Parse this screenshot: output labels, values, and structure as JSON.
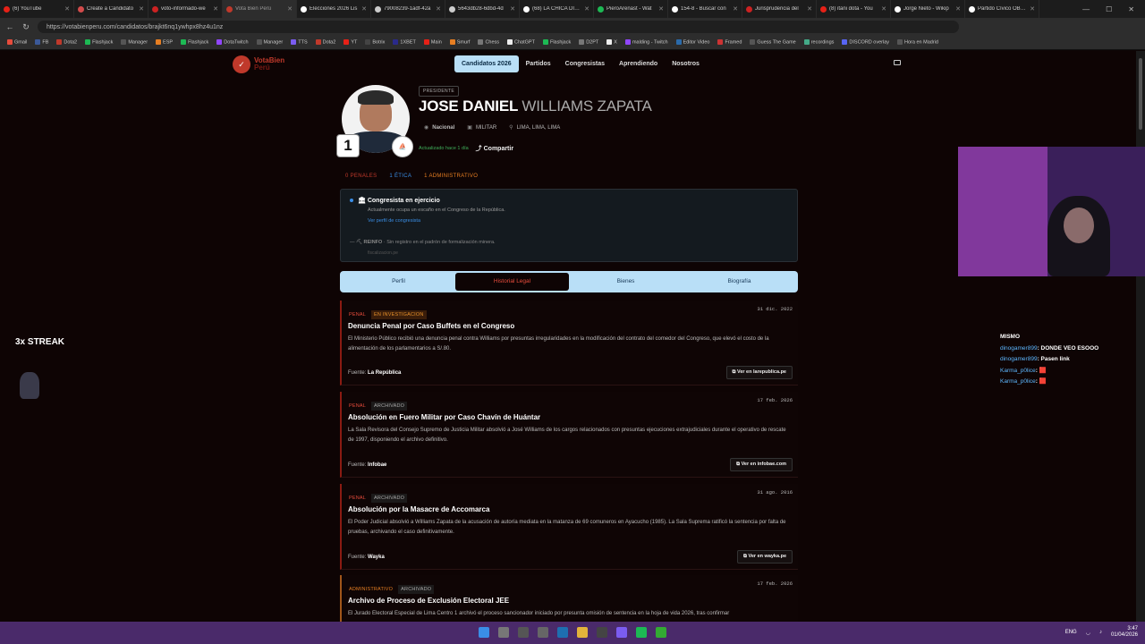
{
  "browser": {
    "tabs": [
      {
        "title": "(6) YouTube",
        "color": "#e62117"
      },
      {
        "title": "Create a Candidato",
        "color": "#d24b4b"
      },
      {
        "title": "voto-informado-we",
        "color": "#c22"
      },
      {
        "title": "Vota Bien Perú",
        "color": "#c0392b",
        "active": true
      },
      {
        "title": "Elecciones 2026 Lis",
        "color": "#fff"
      },
      {
        "title": "79008239-1adf-42a",
        "color": "#ccc"
      },
      {
        "title": "5643db28-6dbd-4d",
        "color": "#ccc"
      },
      {
        "title": "(68) LA CHICA DICE",
        "color": "#fff"
      },
      {
        "title": "PieroArenast - Wat",
        "color": "#1db954"
      },
      {
        "title": "154-8 - Buscar con",
        "color": "#fff"
      },
      {
        "title": "Jurisprudencia del",
        "color": "#c22"
      },
      {
        "title": "(8) itani dota - You",
        "color": "#e62117"
      },
      {
        "title": "Jorge Nieto - Wikip",
        "color": "#fff"
      },
      {
        "title": "Partido Cívico OBRA",
        "color": "#fff"
      }
    ],
    "url": "https://votabienperu.com/candidatos/brajkt6nq1ywhpx8hz4u1nz",
    "bookmarks": [
      "Gmail",
      "FB",
      "Dota2",
      "Flashjack",
      "Manager",
      "ESP",
      "Flashjack",
      "DotaTwitch",
      "Manager",
      "TTS",
      "Dota2",
      "YT",
      "Botrix",
      "1XBET",
      "Main",
      "Smurf",
      "Chess",
      "ChatGPT",
      "Flashjack",
      "D2PT",
      "X",
      "malding - Twitch",
      "Editor Video",
      "Framed",
      "Guess The Game",
      "recordings",
      "DISCORD overlay",
      "Hora en Madrid"
    ]
  },
  "site": {
    "logo_top": "VotaBien",
    "logo_bottom": "Perú",
    "nav": [
      "Candidatos 2026",
      "Partidos",
      "Congresistas",
      "Aprendiendo",
      "Nosotros"
    ],
    "candidate": {
      "role": "PRESIDENTE",
      "first_name": "JOSE DANIEL",
      "last_name": "WILLIAMS ZAPATA",
      "number": "1",
      "scope": "Nacional",
      "profession": "MILITAR",
      "location": "LIMA, LIMA, LIMA",
      "updated": "Actualizado hace 1 día",
      "share": "Compartir"
    },
    "counts": {
      "penal": "0 PENALES",
      "etica": "1 ÉTICA",
      "admin": "1 ADMINISTRATIVO"
    },
    "alert": {
      "title": "Congresista en ejercicio",
      "desc": "Actualmente ocupa un escaño en el Congreso de la República.",
      "link": "Ver perfil de congresista",
      "reinfo_label": "REINFO",
      "reinfo": "Sin registro en el padrón de formalización minera.",
      "reinfo_note": "fiscalizacion.pe"
    },
    "tabs": [
      "Perfil",
      "Historial Legal",
      "Bienes",
      "Biografía"
    ],
    "records": [
      {
        "type": "PENAL",
        "status": "EN INVESTIGACION",
        "date": "31 dic. 2022",
        "title": "Denuncia Penal por Caso Buffets en el Congreso",
        "desc": "El Ministerio Público recibió una denuncia penal contra Williams por presuntas irregularidades en la modificación del contrato del comedor del Congreso, que elevó el costo de la alimentación de los parlamentarios a S/.80.",
        "source": "La República",
        "button": "Ver en larepublica.pe"
      },
      {
        "type": "PENAL",
        "status": "ARCHIVADO",
        "date": "17 feb. 2026",
        "title": "Absolución en Fuero Militar por Caso Chavín de Huántar",
        "desc": "La Sala Revisora del Consejo Supremo de Justicia Militar absolvió a José Williams de los cargos relacionados con presuntas ejecuciones extrajudiciales durante el operativo de rescate de 1997, disponiendo el archivo definitivo.",
        "source": "Infobae",
        "button": "Ver en infobae.com"
      },
      {
        "type": "PENAL",
        "status": "ARCHIVADO",
        "date": "31 ago. 2016",
        "title": "Absolución por la Masacre de Accomarca",
        "desc": "El Poder Judicial absolvió a Williams Zapata de la acusación de autoría mediata en la matanza de 69 comuneros en Ayacucho (1985). La Sala Suprema ratificó la sentencia por falta de pruebas, archivando el caso definitivamente.",
        "source": "Wayka",
        "button": "Ver en wayka.pe"
      },
      {
        "type": "ADMINISTRATIVO",
        "status": "ARCHIVADO",
        "date": "17 feb. 2026",
        "title": "Archivo de Proceso de Exclusión Electoral JEE",
        "desc": "El Jurado Electoral Especial de Lima Centro 1 archivó el proceso sancionador iniciado por presunta omisión de sentencia en la hoja de vida 2026, tras confirmar",
        "source": "",
        "button": ""
      }
    ],
    "source_label": "Fuente:"
  },
  "overlay": {
    "streak": "3x STREAK",
    "chat": [
      {
        "user": "",
        "msg": "MISMO"
      },
      {
        "user": "dinogamer899",
        "msg": ": DONDE VEO ESOOO"
      },
      {
        "user": "dinogamer899",
        "msg": ": Pasen link"
      },
      {
        "user": "Karma_p0lice",
        "msg": ": 🟥"
      },
      {
        "user": "Karma_p0lice",
        "msg": ": 🟥"
      }
    ]
  },
  "taskbar": {
    "lang": "ENG",
    "time": "3:47",
    "date": "01/04/2026"
  }
}
